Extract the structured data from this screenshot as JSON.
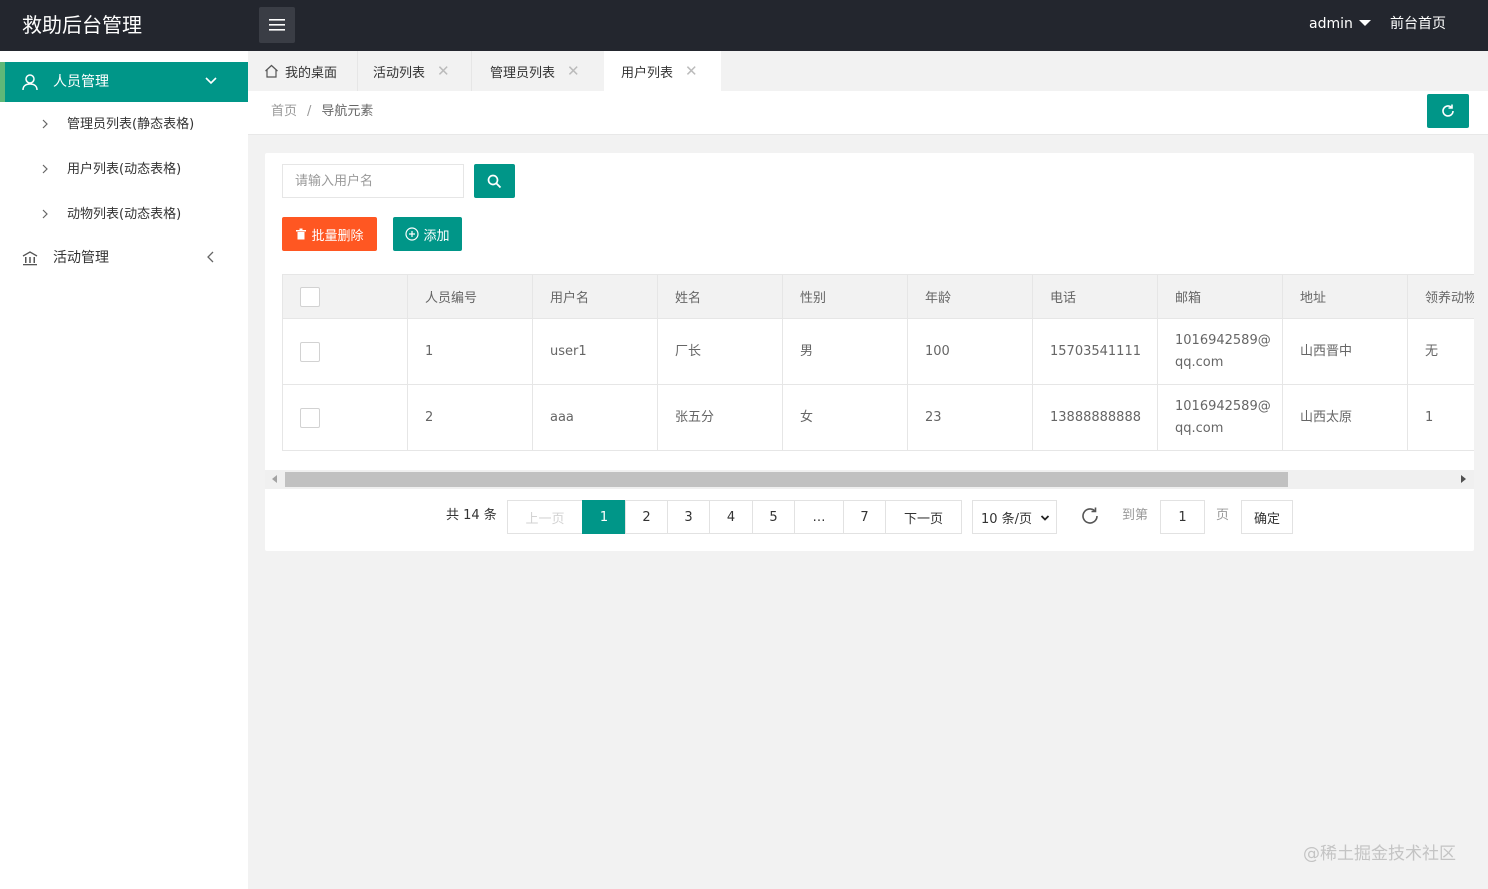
{
  "header": {
    "logo": "救助后台管理",
    "user": "admin",
    "front_link": "前台首页"
  },
  "sidebar": {
    "group1": {
      "label": "人员管理",
      "items": [
        "管理员列表(静态表格)",
        "用户列表(动态表格)",
        "动物列表(动态表格)"
      ]
    },
    "group2": {
      "label": "活动管理"
    }
  },
  "tabs": [
    {
      "label": "我的桌面"
    },
    {
      "label": "活动列表"
    },
    {
      "label": "管理员列表"
    },
    {
      "label": "用户列表"
    }
  ],
  "breadcrumb": {
    "home": "首页",
    "sep": "/",
    "current": "导航元素"
  },
  "toolbar": {
    "search_placeholder": "请输入用户名",
    "batch_delete": "批量删除",
    "add": "添加"
  },
  "table": {
    "headers": [
      "人员编号",
      "用户名",
      "姓名",
      "性别",
      "年龄",
      "电话",
      "邮箱",
      "地址",
      "领养动物"
    ],
    "rows": [
      {
        "id": "1",
        "username": "user1",
        "name": "厂长",
        "gender": "男",
        "age": "100",
        "phone": "15703541111",
        "email": "1016942589@qq.com",
        "address": "山西晋中",
        "pets": "无"
      },
      {
        "id": "2",
        "username": "aaa",
        "name": "张五分",
        "gender": "女",
        "age": "23",
        "phone": "13888888888",
        "email": "1016942589@qq.com",
        "address": "山西太原",
        "pets": "1"
      }
    ]
  },
  "pagination": {
    "total": "共 14 条",
    "prev": "上一页",
    "pages": [
      "1",
      "2",
      "3",
      "4",
      "5",
      "…",
      "7"
    ],
    "next": "下一页",
    "limit": "10 条/页",
    "goto": "到第",
    "page_value": "1",
    "unit": "页",
    "confirm": "确定"
  },
  "watermark": "@稀土掘金技术社区",
  "colors": {
    "primary": "#009688",
    "danger": "#ff5722",
    "header_bg": "#23262e"
  }
}
